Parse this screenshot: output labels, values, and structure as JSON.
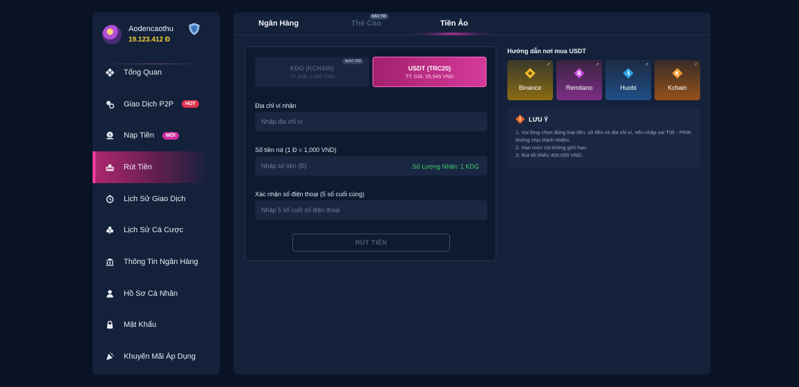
{
  "user": {
    "name": "Aodencaothu",
    "balance": "19.123.412 Đ"
  },
  "sidebar": {
    "items": [
      {
        "label": "Tổng Quan",
        "icon": "overview-icon"
      },
      {
        "label": "Giao Dịch P2P",
        "icon": "p2p-icon",
        "badge": "HOT"
      },
      {
        "label": "Nạp Tiền",
        "icon": "deposit-icon",
        "badge": "MỚI"
      },
      {
        "label": "Rút Tiền",
        "icon": "withdraw-icon",
        "active": true
      },
      {
        "label": "Lịch Sử Giao Dịch",
        "icon": "history-icon"
      },
      {
        "label": "Lịch Sử Cá Cược",
        "icon": "bet-history-icon"
      },
      {
        "label": "Thông Tin Ngân Hàng",
        "icon": "bank-icon"
      },
      {
        "label": "Hồ Sơ Cá Nhân",
        "icon": "profile-icon"
      },
      {
        "label": "Mật Khẩu",
        "icon": "lock-icon"
      },
      {
        "label": "Khuyến Mãi Áp Dụng",
        "icon": "promo-icon"
      }
    ]
  },
  "tabs": {
    "bank": "Ngân Hàng",
    "card": "Thẻ Cào",
    "card_badge": "BẢO TRÌ",
    "crypto": "Tiền Ảo",
    "active": "crypto"
  },
  "withdraw": {
    "coins": [
      {
        "name": "KDG (KCHAIN)",
        "rate": "TỶ GIÁ: 1,000 VND",
        "badge": "BẢO TRÌ",
        "selected": false
      },
      {
        "name": "USDT (TRC20)",
        "rate": "TỶ GIÁ: 25,945 VND",
        "selected": true
      }
    ],
    "address_label": "Địa chỉ ví nhận",
    "address_placeholder": "Nhập địa chỉ ví",
    "amount_label": "Số tiền rút (1 Đ = 1,000 VND)",
    "amount_placeholder": "Nhập số tiền (Đ)",
    "receive_note": "Số Lượng Nhận: 1 KDG",
    "phone_label": "Xác nhận số điện thoại (5 số cuối cùng)",
    "phone_placeholder": "Nhập 5 số cuối số điện thoại",
    "submit_label": "RÚT TIỀN"
  },
  "guide": {
    "title": "Hướng dẫn nơi mua USDT",
    "exchanges": [
      {
        "name": "Binance",
        "color": "#f3ba2f"
      },
      {
        "name": "Remitano",
        "color": "#c64be0"
      },
      {
        "name": "Huobi",
        "color": "#2ea6e8"
      },
      {
        "name": "Kchain",
        "color": "#f39b2f"
      }
    ]
  },
  "notice": {
    "title": "LƯU Ý",
    "icon_color": "#f06a2a",
    "items": [
      "1. Vui lòng chọn đúng loại tiền, số tiền và địa chỉ ví, nếu nhập sai T06 - PINK không chịu trách nhiệm.",
      "2. Hạn mức rút không giới hạn.",
      "3. Rút tối thiểu 400,000 VND."
    ]
  }
}
